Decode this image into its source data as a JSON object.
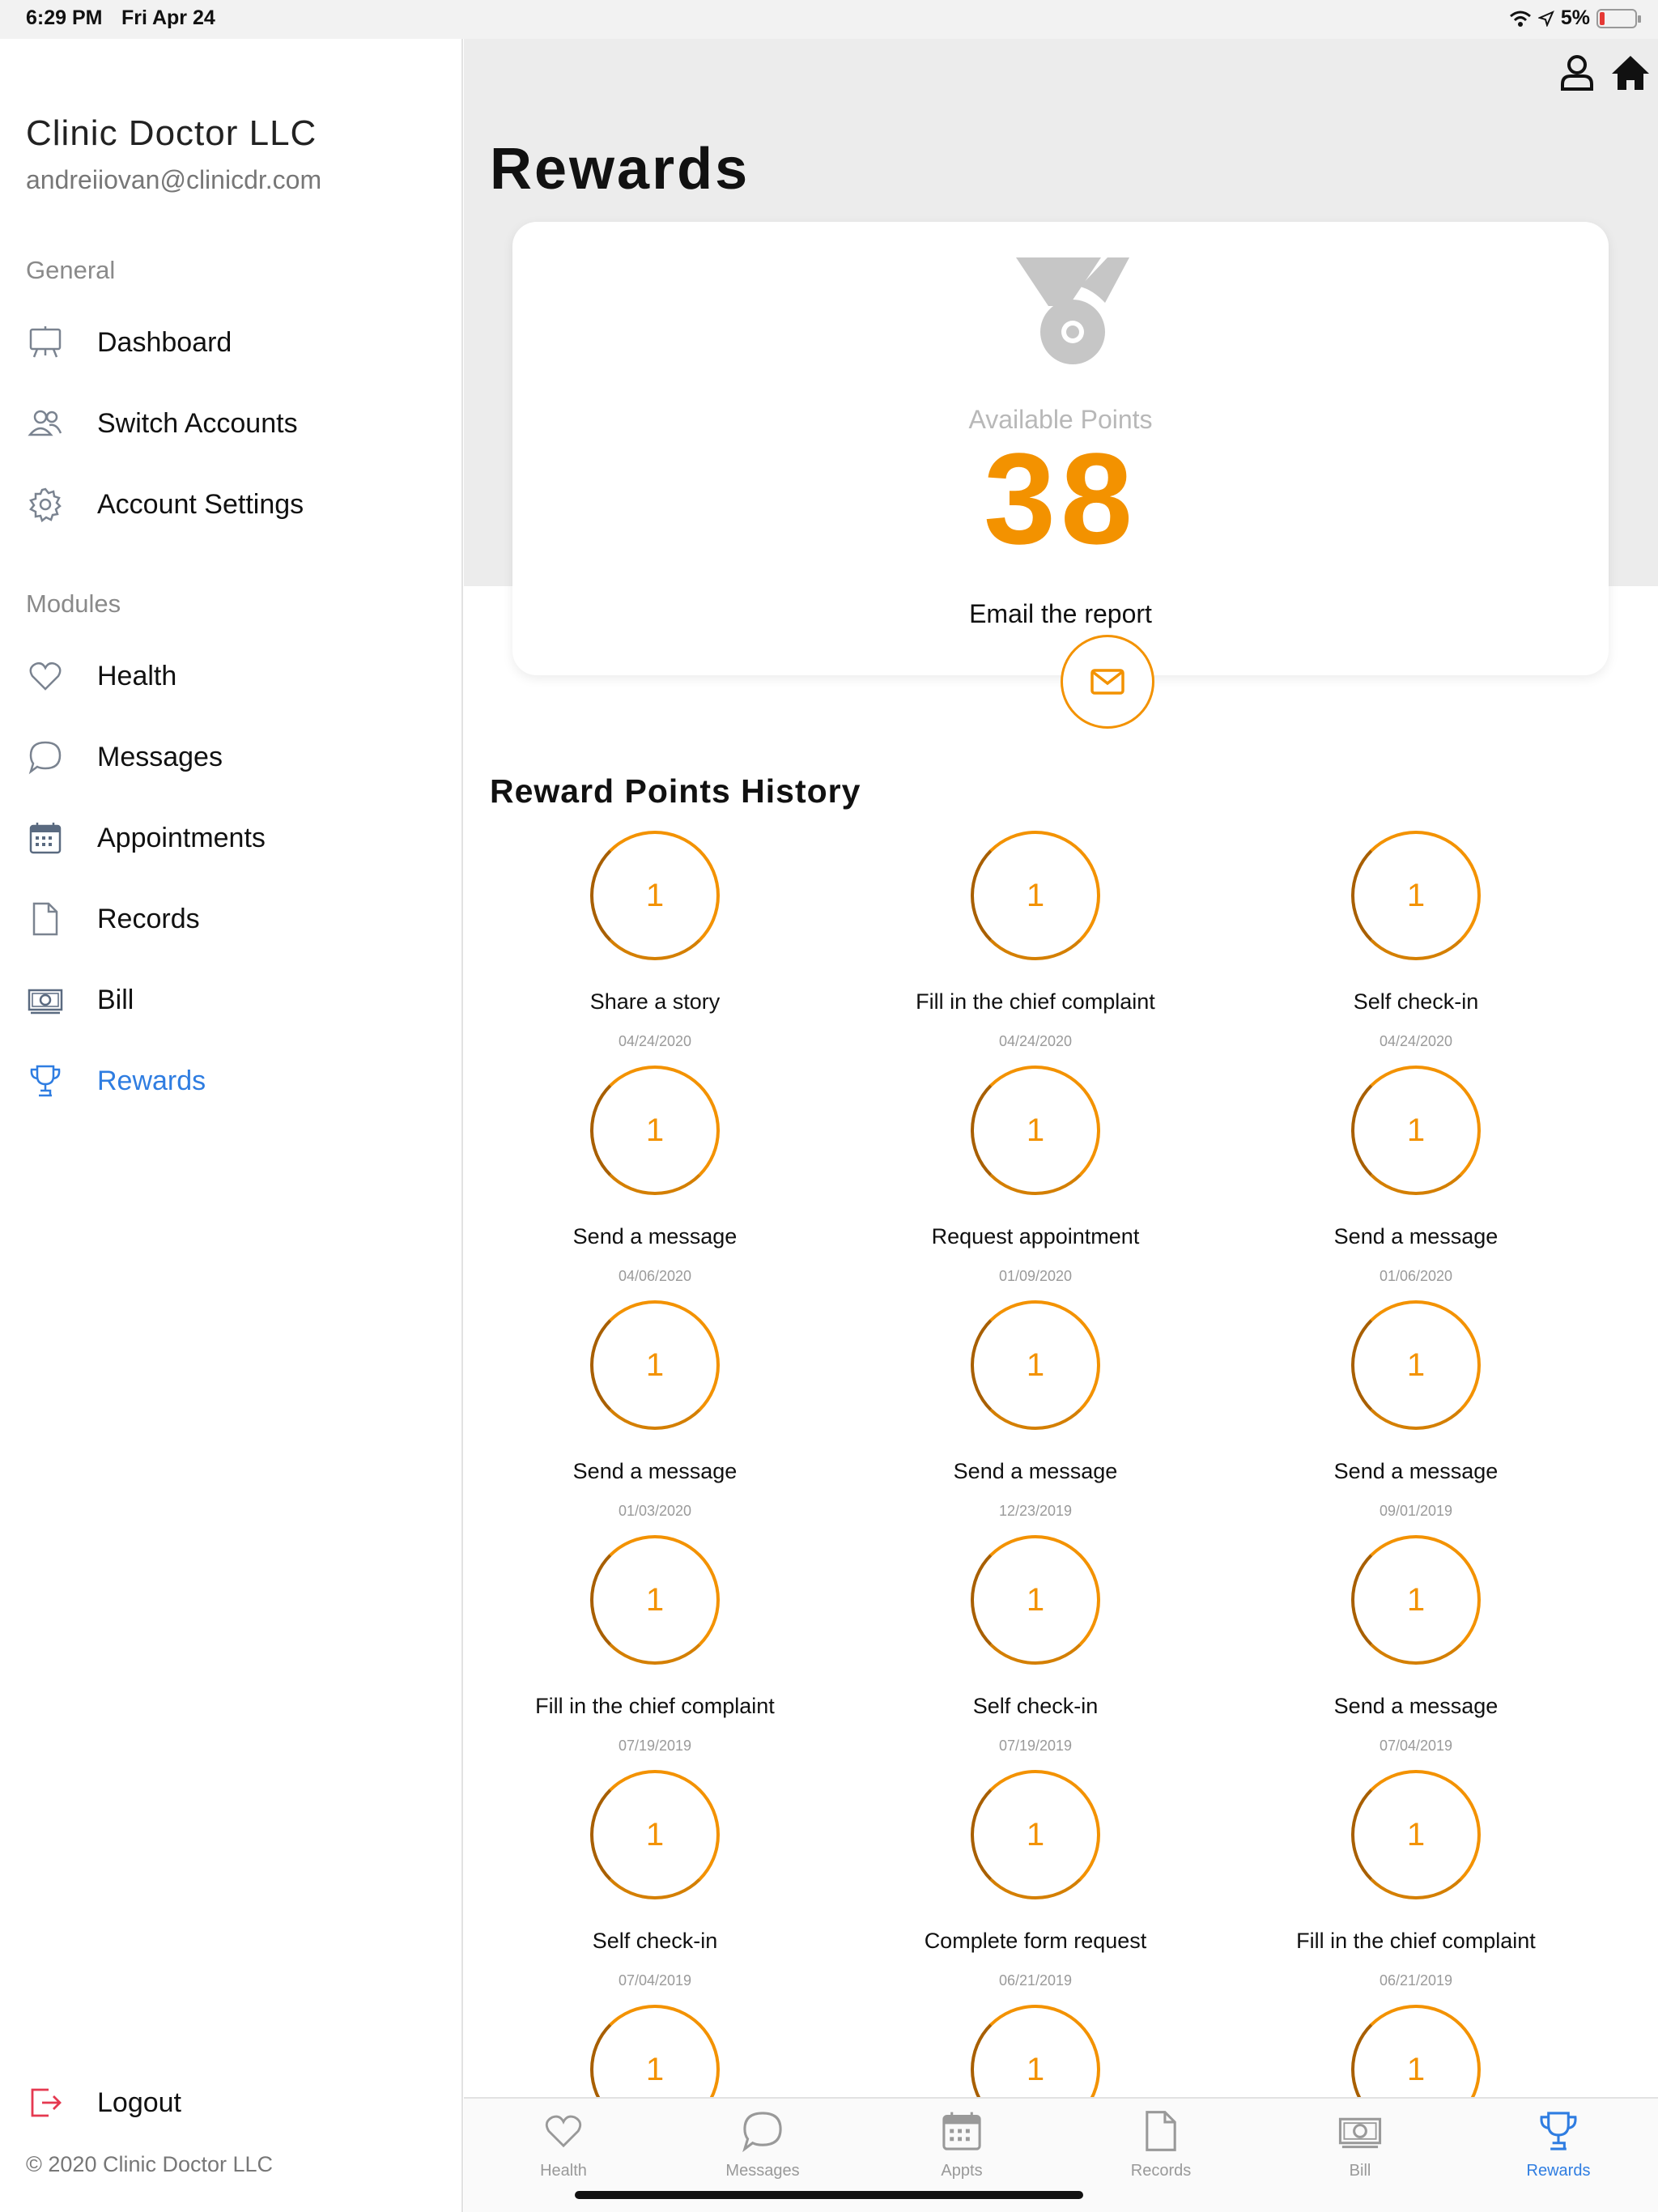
{
  "status_bar": {
    "time": "6:29 PM",
    "date": "Fri Apr 24",
    "battery": "5%"
  },
  "sidebar": {
    "org_name": "Clinic Doctor LLC",
    "email": "andreiiovan@clinicdr.com",
    "general_label": "General",
    "general_items": [
      {
        "label": "Dashboard",
        "icon": "easel-icon"
      },
      {
        "label": "Switch Accounts",
        "icon": "users-icon"
      },
      {
        "label": "Account Settings",
        "icon": "gear-icon"
      }
    ],
    "modules_label": "Modules",
    "module_items": [
      {
        "label": "Health",
        "icon": "heart-icon"
      },
      {
        "label": "Messages",
        "icon": "chat-bubble-icon"
      },
      {
        "label": "Appointments",
        "icon": "calendar-icon"
      },
      {
        "label": "Records",
        "icon": "document-icon"
      },
      {
        "label": "Bill",
        "icon": "cash-icon"
      },
      {
        "label": "Rewards",
        "icon": "trophy-icon",
        "active": true
      }
    ],
    "logout": "Logout",
    "copyright": "© 2020 Clinic Doctor LLC"
  },
  "main": {
    "title": "Rewards",
    "available_points_label": "Available Points",
    "available_points": "38",
    "email_report_label": "Email the report",
    "history_title": "Reward Points History",
    "history": [
      {
        "points": "1",
        "label": "Share a story",
        "date": "04/24/2020"
      },
      {
        "points": "1",
        "label": "Fill in the chief complaint",
        "date": "04/24/2020"
      },
      {
        "points": "1",
        "label": "Self check-in",
        "date": "04/24/2020"
      },
      {
        "points": "1",
        "label": "Send a message",
        "date": "04/06/2020"
      },
      {
        "points": "1",
        "label": "Request appointment",
        "date": "01/09/2020"
      },
      {
        "points": "1",
        "label": "Send a message",
        "date": "01/06/2020"
      },
      {
        "points": "1",
        "label": "Send a message",
        "date": "01/03/2020"
      },
      {
        "points": "1",
        "label": "Send a message",
        "date": "12/23/2019"
      },
      {
        "points": "1",
        "label": "Send a message",
        "date": "09/01/2019"
      },
      {
        "points": "1",
        "label": "Fill in the chief complaint",
        "date": "07/19/2019"
      },
      {
        "points": "1",
        "label": "Self check-in",
        "date": "07/19/2019"
      },
      {
        "points": "1",
        "label": "Send a message",
        "date": "07/04/2019"
      },
      {
        "points": "1",
        "label": "Self check-in",
        "date": "07/04/2019"
      },
      {
        "points": "1",
        "label": "Complete form request",
        "date": "06/21/2019"
      },
      {
        "points": "1",
        "label": "Fill in the chief complaint",
        "date": "06/21/2019"
      },
      {
        "points": "1",
        "label": "",
        "date": ""
      },
      {
        "points": "1",
        "label": "",
        "date": ""
      },
      {
        "points": "1",
        "label": "",
        "date": ""
      }
    ]
  },
  "tabbar": [
    {
      "label": "Health",
      "icon": "heart-icon"
    },
    {
      "label": "Messages",
      "icon": "chat-bubble-icon"
    },
    {
      "label": "Appts",
      "icon": "calendar-icon"
    },
    {
      "label": "Records",
      "icon": "document-icon"
    },
    {
      "label": "Bill",
      "icon": "cash-icon"
    },
    {
      "label": "Rewards",
      "icon": "trophy-icon",
      "active": true
    }
  ],
  "colors": {
    "accent_orange": "#f39200",
    "active_blue": "#2f7de1",
    "logout_red": "#e53950"
  }
}
